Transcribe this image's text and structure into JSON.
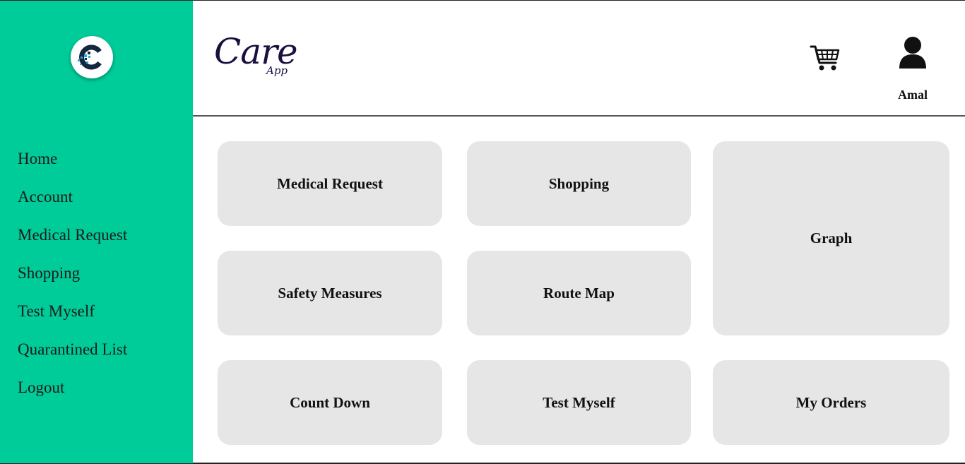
{
  "sidebar": {
    "logo_icon": "care-app-c-logo",
    "items": [
      {
        "label": "Home"
      },
      {
        "label": "Account"
      },
      {
        "label": "Medical Request"
      },
      {
        "label": "Shopping"
      },
      {
        "label": "Test Myself"
      },
      {
        "label": "Quarantined List"
      },
      {
        "label": "Logout"
      }
    ]
  },
  "header": {
    "brand_main": "Care",
    "brand_sub": "App",
    "cart_icon": "cart-icon",
    "user_icon": "user-icon",
    "user_name": "Amal"
  },
  "tiles": [
    {
      "label": "Medical Request"
    },
    {
      "label": "Shopping"
    },
    {
      "label": "Graph"
    },
    {
      "label": "Safety Measures"
    },
    {
      "label": "Route Map"
    },
    {
      "label": "Count Down"
    },
    {
      "label": "Test Myself"
    },
    {
      "label": "My Orders"
    }
  ],
  "colors": {
    "sidebar": "#00cc99",
    "tile": "#e6e6e6",
    "brand": "#1b0f3f",
    "logo_dark": "#15263f",
    "logo_accent": "#2aa6d8"
  }
}
